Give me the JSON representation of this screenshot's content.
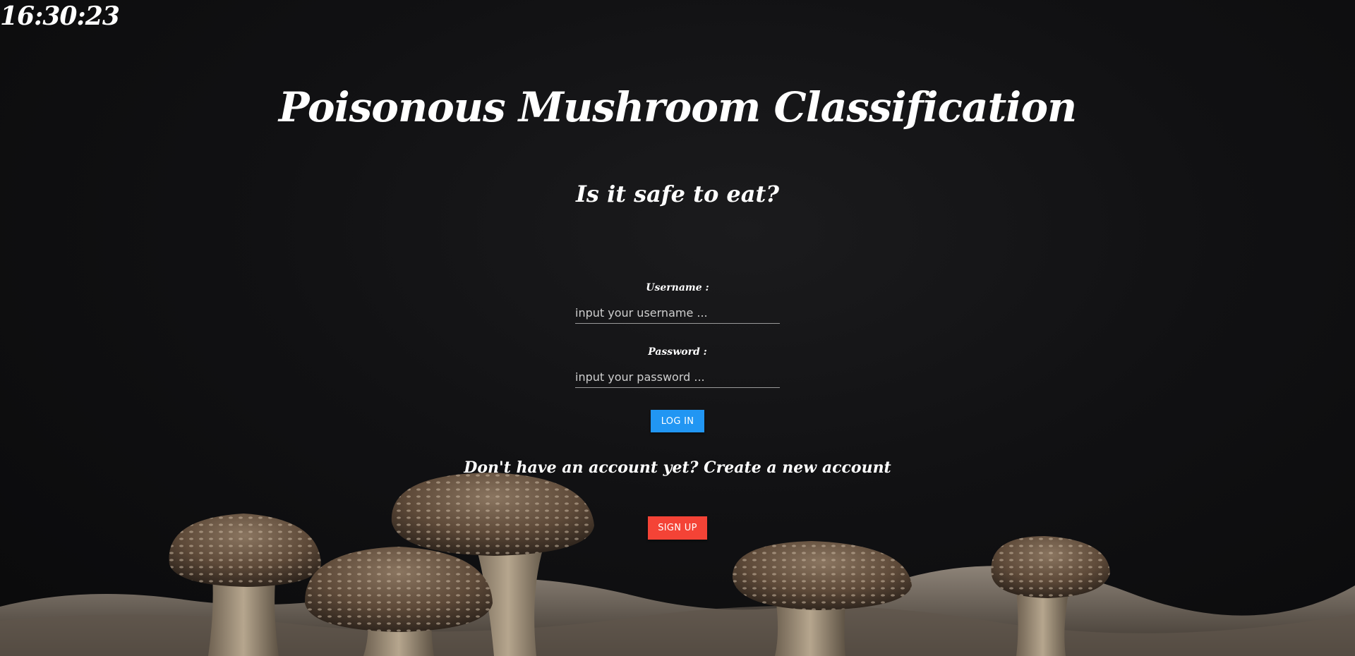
{
  "clock": "16:30:23",
  "title": "Poisonous Mushroom Classification",
  "subtitle": "Is it safe to eat?",
  "login": {
    "username_label": "Username :",
    "username_placeholder": "input your username ...",
    "password_label": "Password :",
    "password_placeholder": "input your password ...",
    "login_button": "LOG IN"
  },
  "signup": {
    "prompt": "Don't have an account yet? Create a new account",
    "button": "SIGN UP"
  },
  "colors": {
    "login_button": "#2196f3",
    "signup_button": "#f44336"
  },
  "background": {
    "image_icon": "mushroom-photo"
  }
}
